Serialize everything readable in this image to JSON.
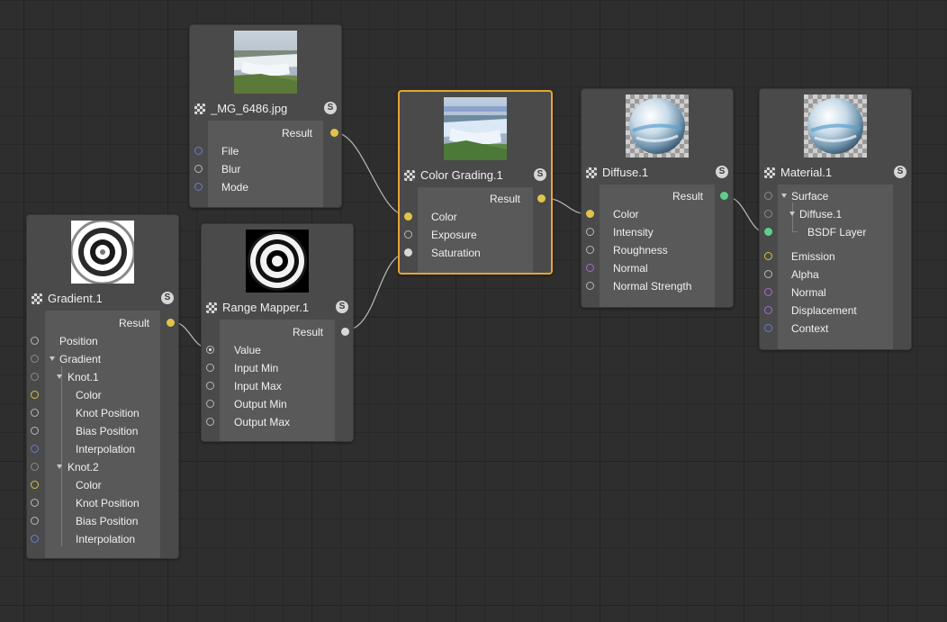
{
  "colors": {
    "canvas": "#2e2e2e",
    "node_bg": "#4a4a4a",
    "port_panel": "#595959",
    "selected_border": "#e6a632",
    "port_yellow": "#e0c44a",
    "port_white": "#d8d8d8",
    "port_green": "#5fcf8c",
    "port_blue": "#6a7bd0",
    "port_purple": "#a56ad6"
  },
  "nodes": {
    "image": {
      "title": "_MG_6486.jpg",
      "s_badge": "S",
      "thumbnail": "waterfall-image-thumbnail",
      "output": "Result",
      "inputs": [
        "File",
        "Blur",
        "Mode"
      ]
    },
    "gradient": {
      "title": "Gradient.1",
      "s_badge": "S",
      "thumbnail": "concentric-rings-thumbnail",
      "output": "Result",
      "inputs": {
        "position": "Position",
        "gradient": "Gradient",
        "knot1": "Knot.1",
        "knot1_color": "Color",
        "knot1_knot_position": "Knot Position",
        "knot1_bias_position": "Bias Position",
        "knot1_interpolation": "Interpolation",
        "knot2": "Knot.2",
        "knot2_color": "Color",
        "knot2_knot_position": "Knot Position",
        "knot2_bias_position": "Bias Position",
        "knot2_interpolation": "Interpolation"
      }
    },
    "range_mapper": {
      "title": "Range Mapper.1",
      "s_badge": "S",
      "thumbnail": "high-contrast-rings-thumbnail",
      "output": "Result",
      "inputs": [
        "Value",
        "Input Min",
        "Input Max",
        "Output Min",
        "Output Max"
      ]
    },
    "color_grading": {
      "title": "Color Grading.1",
      "s_badge": "S",
      "thumbnail": "graded-waterfall-thumbnail",
      "output": "Result",
      "inputs": [
        "Color",
        "Exposure",
        "Saturation"
      ]
    },
    "diffuse": {
      "title": "Diffuse.1",
      "s_badge": "S",
      "thumbnail": "sphere-preview-thumbnail",
      "output": "Result",
      "inputs": [
        "Color",
        "Intensity",
        "Roughness",
        "Normal",
        "Normal Strength"
      ]
    },
    "material": {
      "title": "Material.1",
      "s_badge": "S",
      "thumbnail": "sphere-preview-thumbnail",
      "inputs": {
        "surface": "Surface",
        "diffuse": "Diffuse.1",
        "bsdf_layer": "BSDF Layer",
        "emission": "Emission",
        "alpha": "Alpha",
        "normal": "Normal",
        "displacement": "Displacement",
        "context": "Context"
      }
    }
  }
}
